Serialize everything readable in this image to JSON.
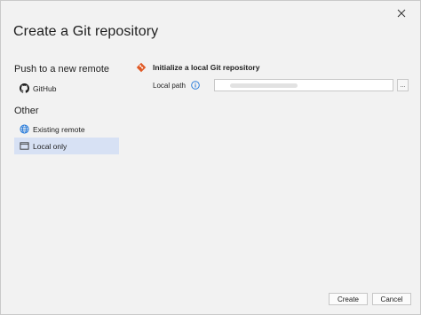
{
  "dialog": {
    "title": "Create a Git repository"
  },
  "sidebar": {
    "push_section_label": "Push to a new remote",
    "other_section_label": "Other",
    "items": [
      {
        "label": "GitHub",
        "icon": "github-icon"
      },
      {
        "label": "Existing remote",
        "icon": "globe-icon"
      },
      {
        "label": "Local only",
        "icon": "folder-icon",
        "selected": true
      }
    ]
  },
  "main": {
    "heading": "Initialize a local Git repository",
    "local_path_label": "Local path",
    "local_path_value": "",
    "browse_label": "..."
  },
  "footer": {
    "create_label": "Create",
    "cancel_label": "Cancel"
  },
  "colors": {
    "selected_bg": "#d7e1f4",
    "info_blue": "#1a73d9",
    "git_orange": "#e05a26"
  }
}
